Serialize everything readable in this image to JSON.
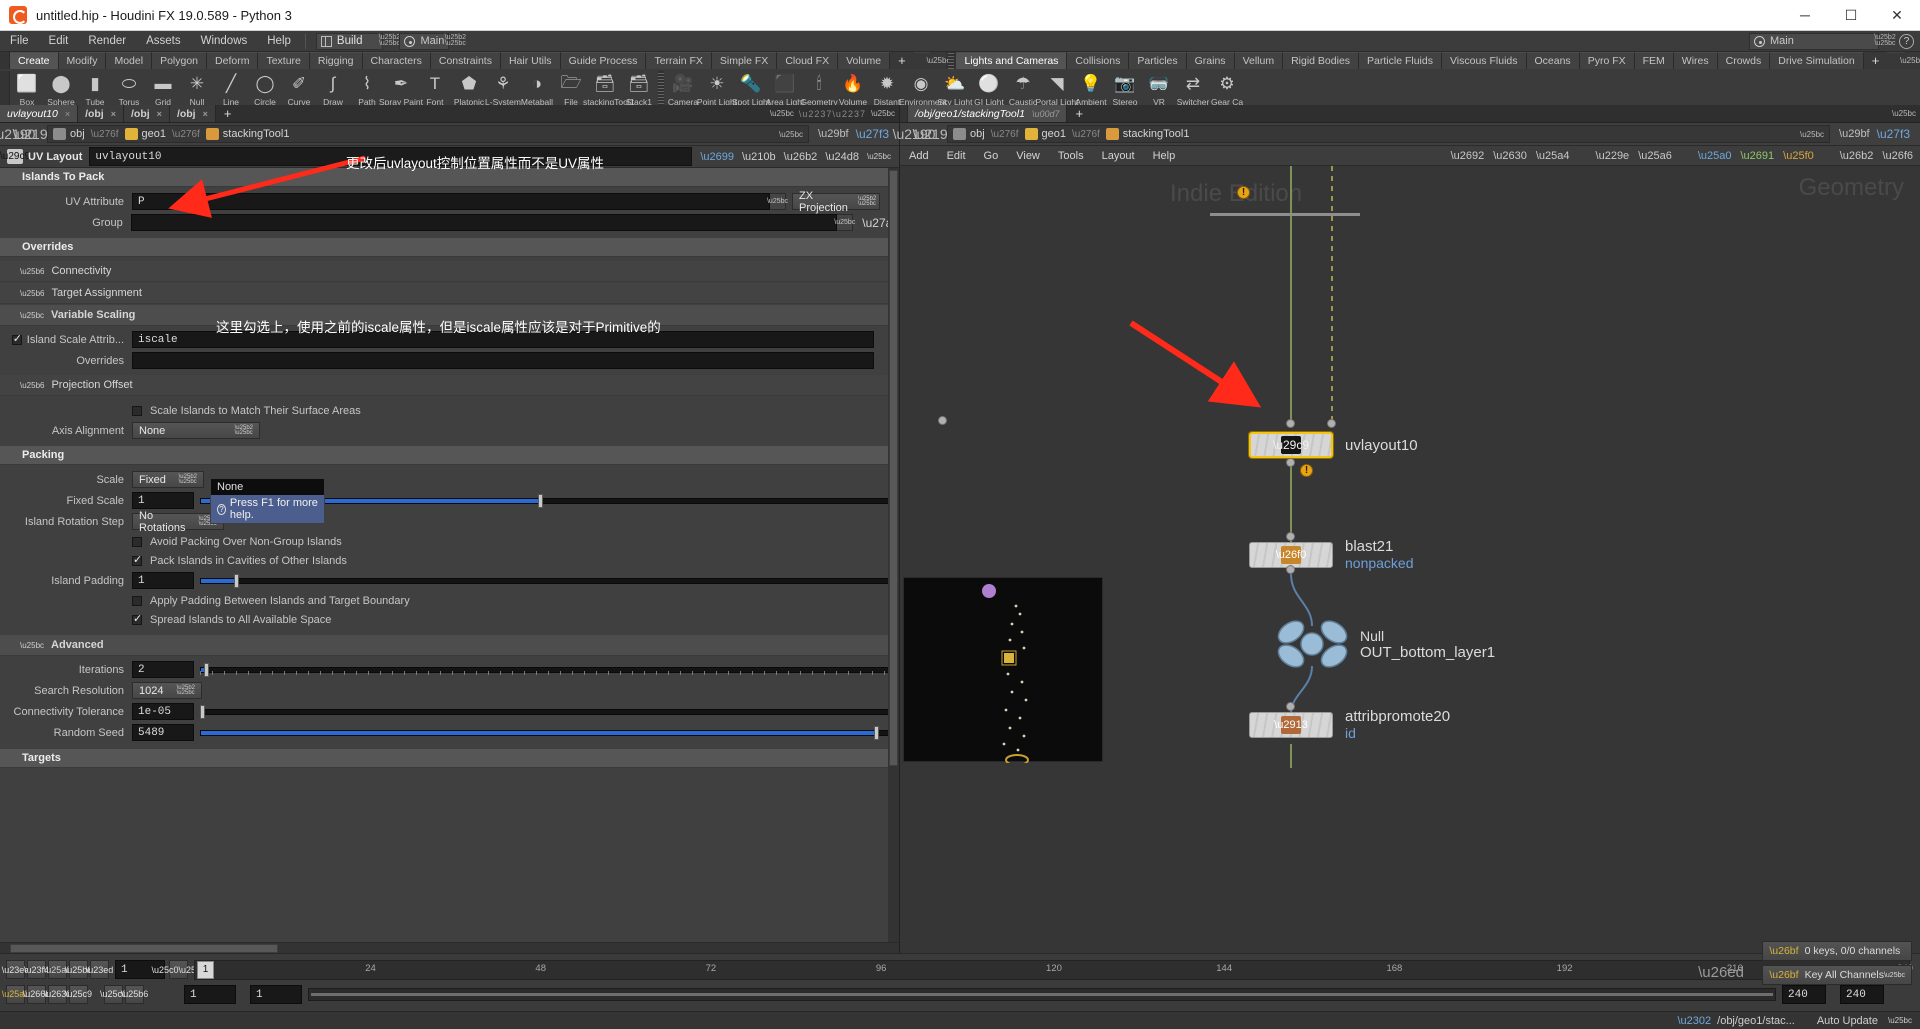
{
  "window": {
    "title": "untitled.hip - Houdini FX 19.0.589 - Python 3",
    "minimize": "─",
    "maximize": "☐",
    "close": "✕"
  },
  "menubar": {
    "items": [
      "File",
      "Edit",
      "Render",
      "Assets",
      "Windows",
      "Help"
    ],
    "desktop": "Build",
    "radial": "Main",
    "right_desktop": "Main"
  },
  "shelf": {
    "left_tabs": [
      "Create",
      "Modify",
      "Model",
      "Polygon",
      "Deform",
      "Texture",
      "Rigging",
      "Characters",
      "Constraints",
      "Hair Utils",
      "Guide Process",
      "Terrain FX",
      "Simple FX",
      "Cloud FX",
      "Volume"
    ],
    "left_active": "Create",
    "left_plus": "+",
    "right_tabs": [
      "Lights and Cameras",
      "Collisions",
      "Particles",
      "Grains",
      "Vellum",
      "Rigid Bodies",
      "Particle Fluids",
      "Viscous Fluids",
      "Oceans",
      "Pyro FX",
      "FEM",
      "Wires",
      "Crowds",
      "Drive Simulation"
    ],
    "right_active": "Lights and Cameras",
    "right_plus": "+",
    "left_items": [
      {
        "label": "Box",
        "icon": "box-icon",
        "glyph": "⬜"
      },
      {
        "label": "Sphere",
        "icon": "sphere-icon",
        "glyph": "⬤"
      },
      {
        "label": "Tube",
        "icon": "tube-icon",
        "glyph": "▮"
      },
      {
        "label": "Torus",
        "icon": "torus-icon",
        "glyph": "⬭"
      },
      {
        "label": "Grid",
        "icon": "grid-icon",
        "glyph": "▬"
      },
      {
        "label": "Null",
        "icon": "null-icon",
        "glyph": "✳"
      },
      {
        "label": "Line",
        "icon": "line-icon",
        "glyph": "╱"
      },
      {
        "label": "Circle",
        "icon": "circle-icon",
        "glyph": "◯"
      },
      {
        "label": "Curve",
        "icon": "curve-icon",
        "glyph": "✐"
      },
      {
        "label": "Draw Curve",
        "icon": "draw-curve-icon",
        "glyph": "∫"
      },
      {
        "label": "Path",
        "icon": "path-icon",
        "glyph": "⌇"
      },
      {
        "label": "Spray Paint",
        "icon": "spray-paint-icon",
        "glyph": "✒"
      },
      {
        "label": "Font",
        "icon": "font-icon",
        "glyph": "T"
      },
      {
        "label": "Platonic Solids",
        "icon": "platonic-solids-icon",
        "glyph": "⬟"
      },
      {
        "label": "L-System",
        "icon": "lsystem-icon",
        "glyph": "⚘"
      },
      {
        "label": "Metaball",
        "icon": "metaball-icon",
        "glyph": "◑"
      },
      {
        "label": "File",
        "icon": "file-icon",
        "glyph": "🗁"
      },
      {
        "label": "stackingTool1",
        "icon": "stacking-tool-icon",
        "glyph": "🗃"
      },
      {
        "label": "Stack1",
        "icon": "stack-icon",
        "glyph": "🗃"
      }
    ],
    "right_items": [
      {
        "label": "Camera",
        "icon": "camera-icon",
        "glyph": "🎥"
      },
      {
        "label": "Point Light",
        "icon": "point-light-icon",
        "glyph": "☀"
      },
      {
        "label": "Spot Light",
        "icon": "spot-light-icon",
        "glyph": "🔦"
      },
      {
        "label": "Area Light",
        "icon": "area-light-icon",
        "glyph": "⬛"
      },
      {
        "label": "Geometry Light",
        "icon": "geometry-light-icon",
        "glyph": "🕯"
      },
      {
        "label": "Volume Light",
        "icon": "volume-light-icon",
        "glyph": "🔥"
      },
      {
        "label": "Distant Light",
        "icon": "distant-light-icon",
        "glyph": "✹"
      },
      {
        "label": "Environment Light",
        "icon": "environment-light-icon",
        "glyph": "◉"
      },
      {
        "label": "Sky Light",
        "icon": "sky-light-icon",
        "glyph": "⛅"
      },
      {
        "label": "GI Light",
        "icon": "gi-light-icon",
        "glyph": "⚪"
      },
      {
        "label": "Caustic Light",
        "icon": "caustic-light-icon",
        "glyph": "☂"
      },
      {
        "label": "Portal Light",
        "icon": "portal-light-icon",
        "glyph": "◥"
      },
      {
        "label": "Ambient Light",
        "icon": "ambient-light-icon",
        "glyph": "💡"
      },
      {
        "label": "Stereo Camera",
        "icon": "stereo-camera-icon",
        "glyph": "📷"
      },
      {
        "label": "VR Camera",
        "icon": "vr-camera-icon",
        "glyph": "🥽"
      },
      {
        "label": "Switcher",
        "icon": "switcher-icon",
        "glyph": "⇄"
      },
      {
        "label": "Gear Ca",
        "icon": "gear-camera-icon",
        "glyph": "⚙"
      }
    ]
  },
  "left_pane": {
    "tabs": [
      {
        "label": "uvlayout10",
        "active": true,
        "italic": true
      },
      {
        "label": "/obj",
        "active": false,
        "italic": false
      },
      {
        "label": "/obj",
        "active": false,
        "italic": false
      },
      {
        "label": "/obj",
        "active": false,
        "italic": false
      }
    ],
    "tab_close": "×",
    "tab_plus": "+",
    "breadcrumb": [
      "obj",
      "geo1",
      "stackingTool1"
    ],
    "param_header": {
      "type_label": "UV Layout",
      "node_name": "uvlayout10"
    },
    "sections": {
      "islands_to_pack": "Islands To Pack",
      "overrides": "Overrides",
      "packing": "Packing",
      "advanced": "Advanced",
      "targets": "Targets"
    },
    "params": {
      "uv_attribute_label": "UV Attribute",
      "uv_attribute_value": "P",
      "projection_button": "ZX Projection",
      "group_label": "Group",
      "group_value": "",
      "connectivity": "Connectivity",
      "target_assignment": "Target Assignment",
      "variable_scaling": "Variable Scaling",
      "island_scale_attrib_label": "Island Scale Attrib...",
      "island_scale_attrib_value": "iscale",
      "island_scale_attrib_checked": true,
      "overrides_label": "Overrides",
      "overrides_value": "",
      "projection_offset": "Projection Offset",
      "scale_islands_label": "Scale Islands to Match Their Surface Areas",
      "scale_islands_checked": false,
      "axis_alignment_label": "Axis Alignment",
      "axis_alignment_value": "None",
      "scale_label": "Scale",
      "scale_value": "Fixed",
      "fixed_scale_label": "Fixed Scale",
      "fixed_scale_value": "1",
      "island_rotation_step_label": "Island Rotation Step",
      "island_rotation_step_value": "No Rotations",
      "avoid_packing_label": "Avoid Packing Over Non-Group Islands",
      "avoid_packing_checked": false,
      "pack_cavities_label": "Pack Islands in Cavities of Other Islands",
      "pack_cavities_checked": true,
      "island_padding_label": "Island Padding",
      "island_padding_value": "1",
      "apply_padding_label": "Apply Padding Between Islands and Target Boundary",
      "apply_padding_checked": false,
      "spread_islands_label": "Spread Islands to All Available Space",
      "spread_islands_checked": true,
      "iterations_label": "Iterations",
      "iterations_value": "2",
      "search_resolution_label": "Search Resolution",
      "search_resolution_value": "1024",
      "connectivity_tolerance_label": "Connectivity Tolerance",
      "connectivity_tolerance_value": "1e-05",
      "random_seed_label": "Random Seed",
      "random_seed_value": "5489"
    },
    "tooltip": {
      "title": "None",
      "help": "Press F1 for more help."
    }
  },
  "right_pane": {
    "tab_label": "/obj/geo1/stackingTool1",
    "tab_plus": "+",
    "breadcrumb": [
      "obj",
      "geo1",
      "stackingTool1"
    ],
    "menu_items": [
      "Add",
      "Edit",
      "Go",
      "View",
      "Tools",
      "Layout",
      "Help"
    ],
    "watermark_left": "Indie Edition",
    "watermark_right": "Geometry",
    "nodes": [
      {
        "name": "uvlayout10",
        "sub": "",
        "icon": "uvlayout-icon",
        "glyph": "⧉",
        "selected": true,
        "badge": "!"
      },
      {
        "name": "blast21",
        "sub": "nonpacked",
        "icon": "blast-icon",
        "glyph": "⛰",
        "selected": false,
        "badge": ""
      },
      {
        "name": "OUT_bottom_layer1",
        "sub": "Null",
        "icon": "null-node-icon",
        "glyph": "✹",
        "selected": false,
        "badge": ""
      },
      {
        "name": "attribpromote20",
        "sub": "id",
        "icon": "attribpromote-icon",
        "glyph": "⤓",
        "selected": false,
        "badge": ""
      }
    ]
  },
  "timeline": {
    "frame_field": "1",
    "current_frame": "1",
    "start_field": "1",
    "end_field": "1",
    "range_end": "240",
    "range_end2": "240",
    "ticks": [
      "24",
      "48",
      "72",
      "96",
      "120",
      "144",
      "168",
      "192",
      "216",
      "240"
    ],
    "playhead_label": "1",
    "channels_label": "0 keys, 0/0 channels",
    "key_all_label": "Key All Channels",
    "auto_update": "Auto Update",
    "status_path": "/obj/geo1/stac..."
  },
  "annotations": {
    "note1": "更改后uvlayout控制位置属性而不是UV属性",
    "note2": "这里勾选上，使用之前的iscale属性，但是iscale属性应该是对于Primitive的",
    "arrow_color": "#ff2a1a"
  },
  "colors": {
    "accent_blue": "#2a6ad4",
    "select_yellow": "#f3c316",
    "node_blue": "#6f9fd8",
    "warn_orange": "#e8a317"
  }
}
